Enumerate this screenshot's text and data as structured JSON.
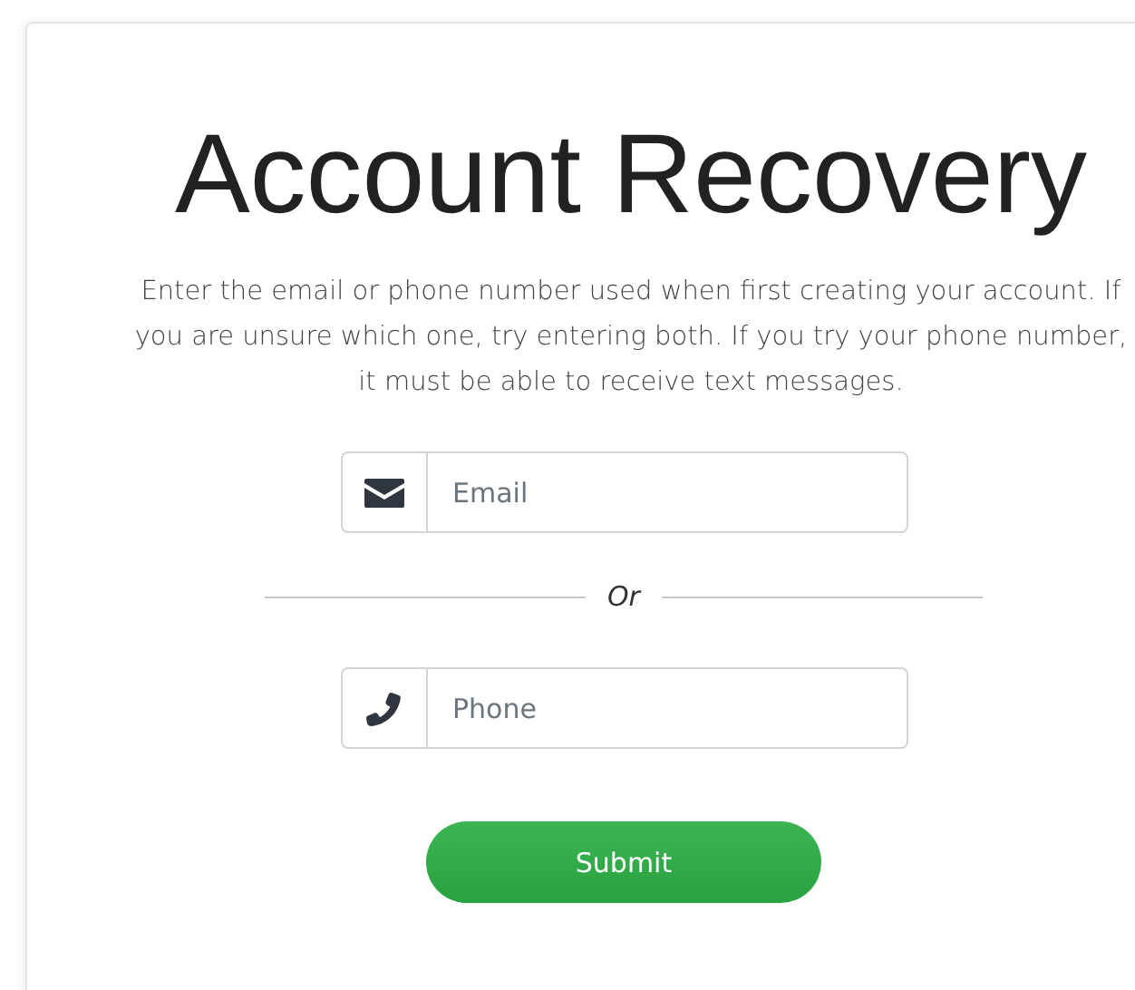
{
  "title": "Account Recovery",
  "description": "Enter the email or phone number used when first creating your account. If you are unsure which one, try entering both. If you try your phone number, it must be able to receive text messages.",
  "fields": [
    {
      "kind": "email",
      "placeholder": "Email"
    },
    {
      "kind": "phone",
      "placeholder": "Phone"
    }
  ],
  "separator": "Or",
  "submit_button": "Submit"
}
